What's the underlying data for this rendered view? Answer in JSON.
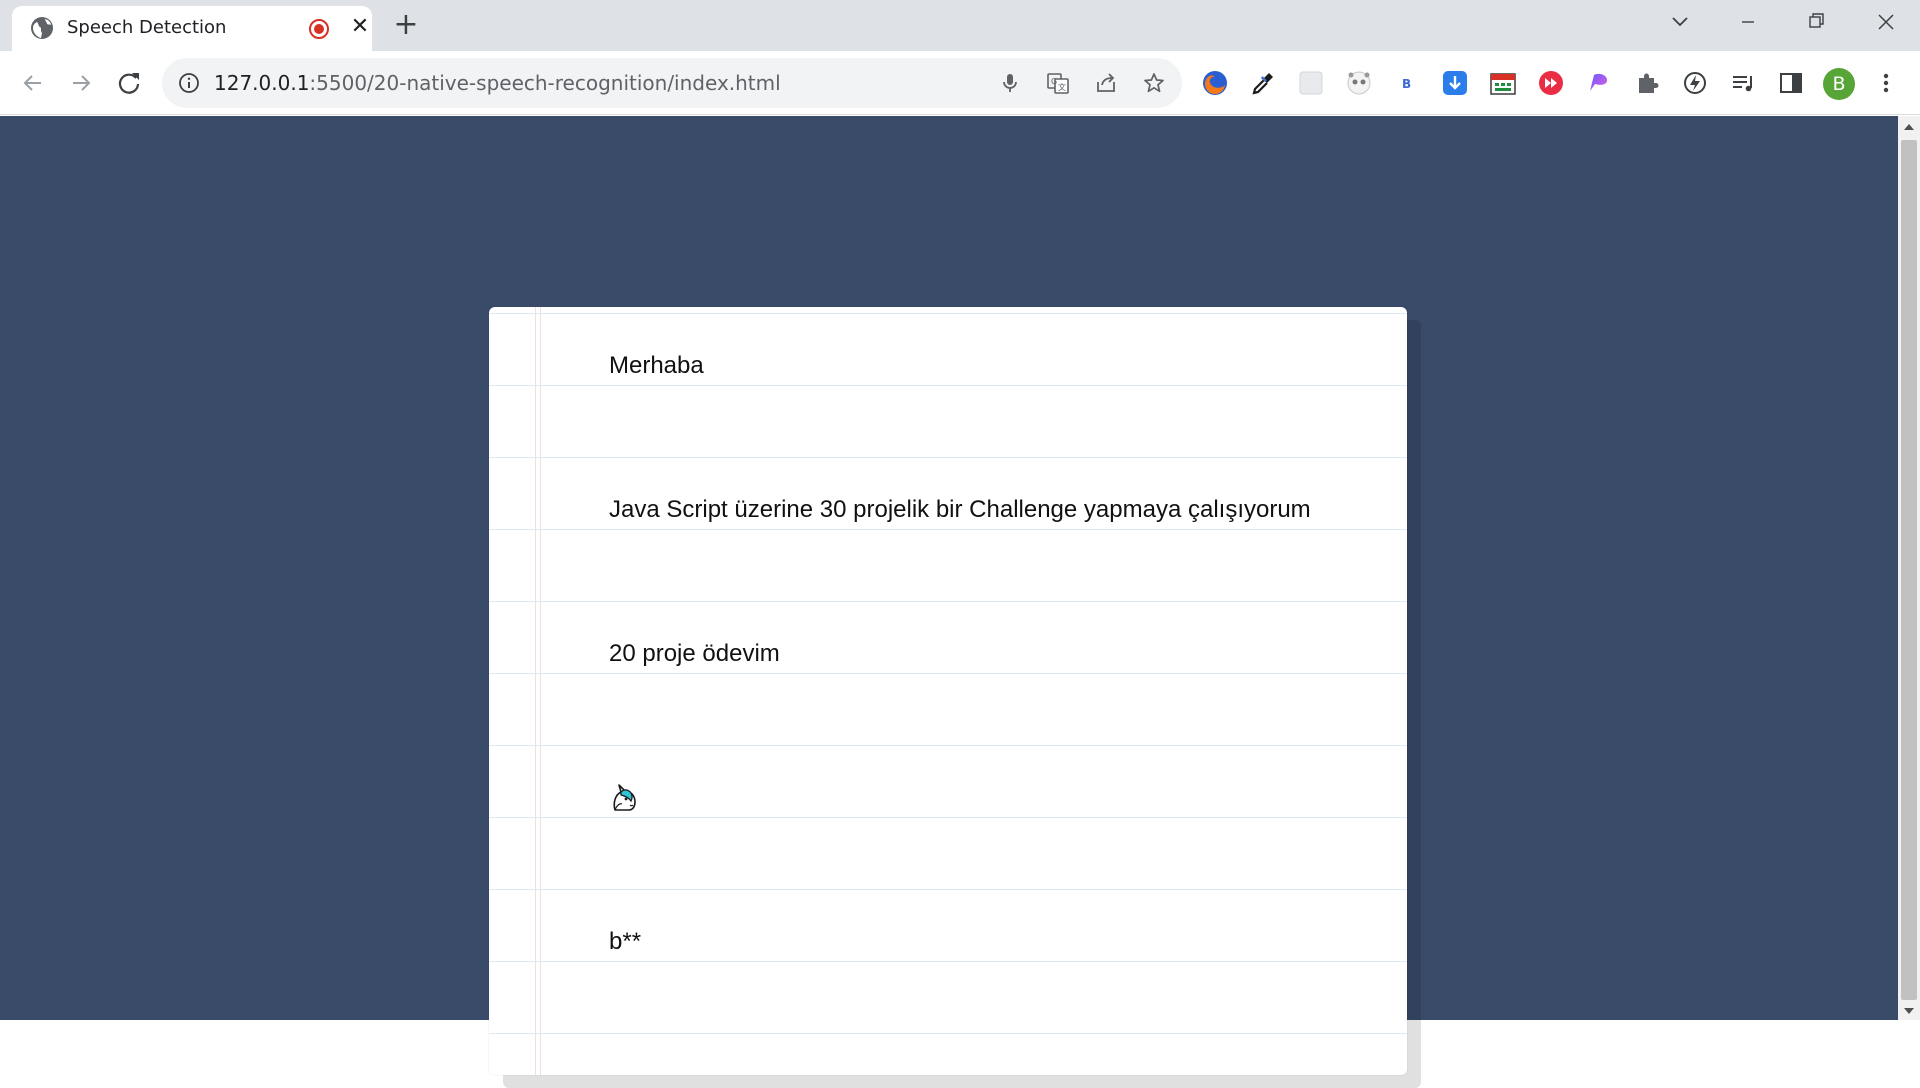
{
  "tab": {
    "title": "Speech Detection",
    "favicon_icon": "globe-icon",
    "recording_icon": "recording-dot-icon",
    "close_label": "✕"
  },
  "newtab_label": "+",
  "address_bar": {
    "host": "127.0.0.1",
    "path": ":5500/20-native-speech-recognition/index.html"
  },
  "toolbar_icons": [
    "back-icon",
    "forward-icon",
    "reload-icon",
    "site-info-icon",
    "microphone-icon",
    "translate-icon",
    "share-icon",
    "bookmark-star-icon"
  ],
  "extensions": [
    "firefox-icon",
    "eyedropper-icon",
    "blank-extension-icon",
    "panda-icon",
    "b-extension-icon",
    "download-icon",
    "calendar-icon",
    "fast-forward-icon",
    "gradient-extension-icon",
    "puzzle-icon",
    "performance-icon",
    "reading-list-icon",
    "side-panel-icon"
  ],
  "profile": {
    "initial": "B",
    "color": "#57a537"
  },
  "colors": {
    "page_background": "#3a4a69",
    "paper": "#ffffff",
    "rule_line": "#dbe9f0",
    "margin_line": "#f1dede"
  },
  "transcript": [
    "Merhaba",
    "Java Script üzerine 30 projelik bir Challenge yapmaya çalışıyorum",
    "20 proje ödevim",
    "",
    "b**"
  ],
  "transcript_emoji": "unicorn-icon"
}
